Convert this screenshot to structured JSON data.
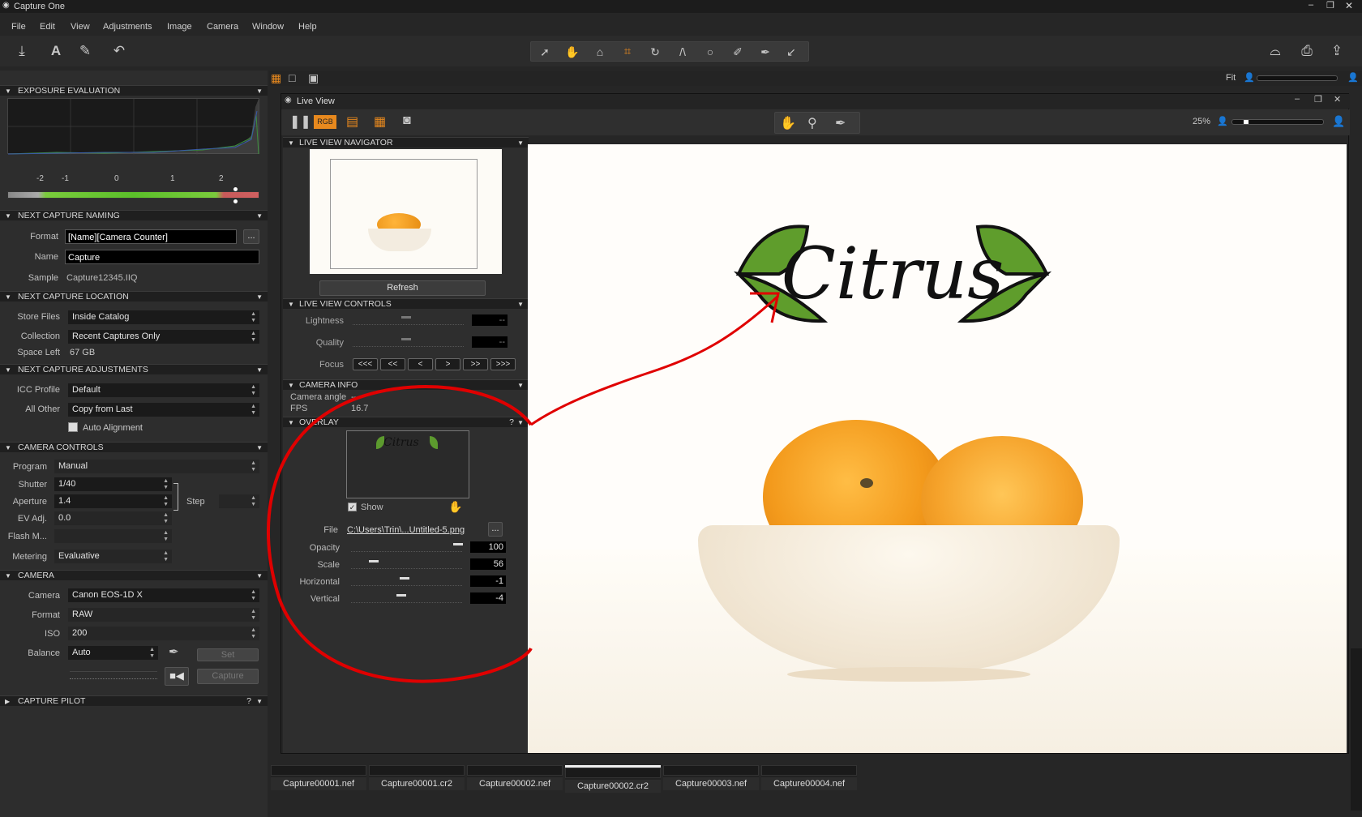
{
  "app": {
    "title": "Capture One"
  },
  "menu": [
    "File",
    "Edit",
    "View",
    "Adjustments",
    "Image",
    "Camera",
    "Window",
    "Help"
  ],
  "topbar": {
    "fit_label": "Fit"
  },
  "exposure": {
    "title": "EXPOSURE EVALUATION",
    "ticks": [
      "-2",
      "-1",
      "0",
      "1",
      "2"
    ]
  },
  "naming": {
    "title": "NEXT CAPTURE NAMING",
    "format_label": "Format",
    "format_value": "[Name][Camera Counter]",
    "name_label": "Name",
    "name_value": "Capture",
    "sample_label": "Sample",
    "sample_value": "Capture12345.IIQ",
    "more_label": "..."
  },
  "location": {
    "title": "NEXT CAPTURE LOCATION",
    "store_label": "Store Files",
    "store_value": "Inside Catalog",
    "collection_label": "Collection",
    "collection_value": "Recent Captures Only",
    "space_label": "Space Left",
    "space_value": "67 GB"
  },
  "adjustments": {
    "title": "NEXT CAPTURE ADJUSTMENTS",
    "icc_label": "ICC Profile",
    "icc_value": "Default",
    "other_label": "All Other",
    "other_value": "Copy from Last",
    "auto_label": "Auto Alignment"
  },
  "camera_controls": {
    "title": "CAMERA CONTROLS",
    "program_label": "Program",
    "program_value": "Manual",
    "shutter_label": "Shutter",
    "shutter_value": "1/40",
    "aperture_label": "Aperture",
    "aperture_value": "1.4",
    "ev_label": "EV Adj.",
    "ev_value": "0.0",
    "flash_label": "Flash M...",
    "step_label": "Step",
    "metering_label": "Metering",
    "metering_value": "Evaluative"
  },
  "camera": {
    "title": "CAMERA",
    "camera_label": "Camera",
    "camera_value": "Canon EOS-1D X",
    "format_label": "Format",
    "format_value": "RAW",
    "iso_label": "ISO",
    "iso_value": "200",
    "balance_label": "Balance",
    "balance_value": "Auto",
    "set_label": "Set",
    "capture_label": "Capture"
  },
  "pilot": {
    "title": "CAPTURE PILOT",
    "help": "?"
  },
  "liveview": {
    "title": "Live View",
    "rgb_label": "RGB",
    "zoom": "25%",
    "navigator_title": "LIVE VIEW NAVIGATOR",
    "refresh_label": "Refresh",
    "controls_title": "LIVE VIEW CONTROLS",
    "lightness_label": "Lightness",
    "lightness_value": "--",
    "quality_label": "Quality",
    "quality_value": "--",
    "focus_label": "Focus",
    "focus_buttons": [
      "<<<",
      "<<",
      "<",
      ">",
      ">>",
      ">>>"
    ],
    "camera_info_title": "CAMERA INFO",
    "camera_angle_label": "Camera angle",
    "camera_angle_value": "--",
    "fps_label": "FPS",
    "fps_value": "16.7",
    "overlay_title": "OVERLAY",
    "overlay_help": "?",
    "show_label": "Show",
    "file_label": "File",
    "file_value": "C:\\Users\\Trin\\...Untitled-5.png",
    "opacity_label": "Opacity",
    "opacity_value": "100",
    "opacity_level": 1.0,
    "scale_label": "Scale",
    "scale_value": "56",
    "horizontal_label": "Horizontal",
    "horizontal_value": "-1",
    "vertical_label": "Vertical",
    "vertical_value": "-4",
    "logo_text": "Citrus"
  },
  "filmstrip": [
    "Capture00001.nef",
    "Capture00001.cr2",
    "Capture00002.nef",
    "Capture00002.cr2",
    "Capture00003.nef",
    "Capture00004.nef"
  ],
  "colors": {
    "accent_orange": "#e8891e",
    "annotation_red": "#e00000",
    "panel_dark": "#2d2d2d"
  }
}
